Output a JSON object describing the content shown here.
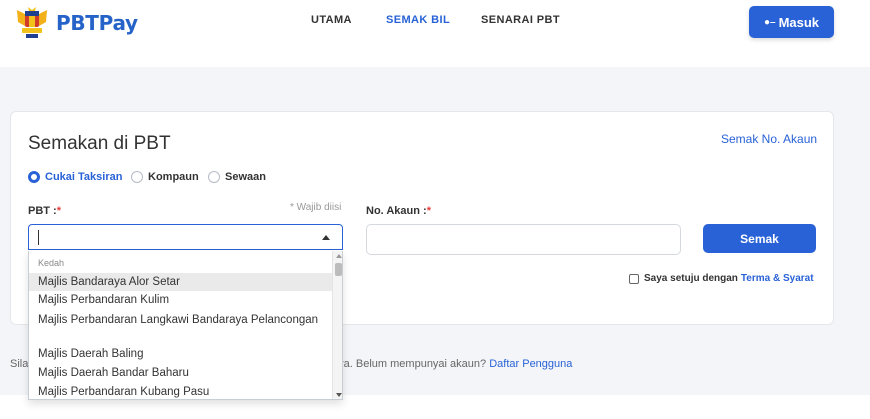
{
  "brand": {
    "name": "PBTPay"
  },
  "nav": {
    "items": [
      {
        "label": "UTAMA"
      },
      {
        "label": "SEMAK BIL"
      },
      {
        "label": "SENARAI PBT"
      }
    ],
    "active": "SEMAK BIL",
    "login_label": "Masuk"
  },
  "card": {
    "title": "Semakan di PBT",
    "semak_akaun_link": "Semak No. Akaun",
    "radios": [
      {
        "label": "Cukai Taksiran",
        "checked": true
      },
      {
        "label": "Kompaun",
        "checked": false
      },
      {
        "label": "Sewaan",
        "checked": false
      }
    ],
    "pbt_label": "PBT :",
    "required_mark": "*",
    "required_note": "* Wajib diisi",
    "akaun_label": "No. Akaun :",
    "akaun_value": "",
    "semak_button": "Semak",
    "agree_text": "Saya setuju dengan",
    "agree_link": "Terma & Syarat"
  },
  "dropdown": {
    "group": "Kedah",
    "items": [
      "Majlis Bandaraya Alor Setar",
      "Majlis Perbandaran Kulim",
      "Majlis Perbandaran Langkawi Bandaraya Pelancongan",
      "Majlis Daerah Baling",
      "Majlis Daerah Bandar Baharu",
      "Majlis Perbandaran Kubang Pasu"
    ],
    "highlighted_index": 0
  },
  "info": {
    "left_text": "Sila",
    "right_text": "tnya. Belum mempunyai akaun?",
    "daftar_link": "Daftar Pengguna"
  },
  "colors": {
    "primary": "#2962d6",
    "required": "#e53e3e",
    "page_bg": "#f3f5f8"
  }
}
